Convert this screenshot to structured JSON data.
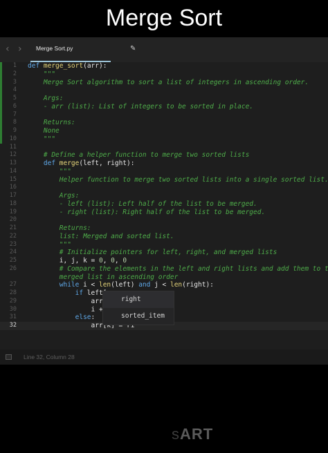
{
  "video_title": "Merge Sort",
  "tab": {
    "filename": "Merge Sort.py"
  },
  "code_lines": [
    {
      "n": "1",
      "tokens": [
        {
          "c": "kw",
          "t": "def "
        },
        {
          "c": "fn",
          "t": "merge_sort"
        },
        {
          "c": "ident",
          "t": "(arr):"
        }
      ]
    },
    {
      "n": "2",
      "tokens": [
        {
          "c": "doc",
          "t": "    \"\"\""
        }
      ]
    },
    {
      "n": "3",
      "tokens": [
        {
          "c": "doc",
          "t": "    Merge Sort algorithm to sort a list of integers in ascending order."
        }
      ]
    },
    {
      "n": "4",
      "tokens": []
    },
    {
      "n": "5",
      "tokens": [
        {
          "c": "doc",
          "t": "    Args:"
        }
      ]
    },
    {
      "n": "6",
      "tokens": [
        {
          "c": "doc",
          "t": "    - arr (list): List of integers to be sorted in place."
        }
      ]
    },
    {
      "n": "7",
      "tokens": []
    },
    {
      "n": "8",
      "tokens": [
        {
          "c": "doc",
          "t": "    Returns:"
        }
      ]
    },
    {
      "n": "9",
      "tokens": [
        {
          "c": "doc",
          "t": "    None"
        }
      ]
    },
    {
      "n": "10",
      "tokens": [
        {
          "c": "doc",
          "t": "    \"\"\""
        }
      ]
    },
    {
      "n": "11",
      "tokens": []
    },
    {
      "n": "12",
      "tokens": [
        {
          "c": "cm",
          "t": "    # Define a helper function to merge two sorted lists"
        }
      ]
    },
    {
      "n": "13",
      "tokens": [
        {
          "c": "kw",
          "t": "    def "
        },
        {
          "c": "fn",
          "t": "merge"
        },
        {
          "c": "ident",
          "t": "(left, right):"
        }
      ]
    },
    {
      "n": "14",
      "tokens": [
        {
          "c": "doc",
          "t": "        \"\"\""
        }
      ]
    },
    {
      "n": "15",
      "tokens": [
        {
          "c": "doc",
          "t": "        Helper function to merge two sorted lists into a single sorted list."
        }
      ]
    },
    {
      "n": "16",
      "tokens": []
    },
    {
      "n": "17",
      "tokens": [
        {
          "c": "doc",
          "t": "        Args:"
        }
      ]
    },
    {
      "n": "18",
      "tokens": [
        {
          "c": "doc",
          "t": "        - left (list): Left half of the list to be merged."
        }
      ]
    },
    {
      "n": "19",
      "tokens": [
        {
          "c": "doc",
          "t": "        - right (list): Right half of the list to be merged."
        }
      ]
    },
    {
      "n": "20",
      "tokens": []
    },
    {
      "n": "21",
      "tokens": [
        {
          "c": "doc",
          "t": "        Returns:"
        }
      ]
    },
    {
      "n": "22",
      "tokens": [
        {
          "c": "doc",
          "t": "        list: Merged and sorted list."
        }
      ]
    },
    {
      "n": "23",
      "tokens": [
        {
          "c": "doc",
          "t": "        \"\"\""
        }
      ]
    },
    {
      "n": "24",
      "tokens": [
        {
          "c": "cm",
          "t": "        # Initialize pointers for left, right, and merged lists"
        }
      ]
    },
    {
      "n": "25",
      "tokens": [
        {
          "c": "ident",
          "t": "        i, j, k = "
        },
        {
          "c": "num",
          "t": "0"
        },
        {
          "c": "ident",
          "t": ", "
        },
        {
          "c": "num",
          "t": "0"
        },
        {
          "c": "ident",
          "t": ", "
        },
        {
          "c": "num",
          "t": "0"
        }
      ]
    },
    {
      "n": "26",
      "tokens": [
        {
          "c": "cm",
          "t": "        # Compare the elements in the left and right lists and add them to the"
        }
      ]
    },
    {
      "n": "",
      "tokens": [
        {
          "c": "cm",
          "t": "        merged list in ascending order"
        }
      ]
    },
    {
      "n": "27",
      "tokens": [
        {
          "c": "kw",
          "t": "        while "
        },
        {
          "c": "ident",
          "t": "i < "
        },
        {
          "c": "fn",
          "t": "len"
        },
        {
          "c": "ident",
          "t": "(left) "
        },
        {
          "c": "kw",
          "t": "and "
        },
        {
          "c": "ident",
          "t": "j < "
        },
        {
          "c": "fn",
          "t": "len"
        },
        {
          "c": "ident",
          "t": "(right):"
        }
      ]
    },
    {
      "n": "28",
      "tokens": [
        {
          "c": "kw",
          "t": "            if "
        },
        {
          "c": "ident",
          "t": "left["
        }
      ]
    },
    {
      "n": "29",
      "tokens": [
        {
          "c": "ident",
          "t": "                arr["
        }
      ]
    },
    {
      "n": "30",
      "tokens": [
        {
          "c": "ident",
          "t": "                i +="
        }
      ]
    },
    {
      "n": "31",
      "tokens": [
        {
          "c": "kw",
          "t": "            else"
        },
        {
          "c": "ident",
          "t": ":"
        }
      ]
    },
    {
      "n": "32",
      "tokens": [
        {
          "c": "ident",
          "t": "                arr[k] = ri"
        }
      ]
    }
  ],
  "current_line": "32",
  "autocomplete": [
    "right",
    "sorted_item"
  ],
  "status": {
    "position": "Line 32, Column 28"
  },
  "watermark": {
    "prefix": "s",
    "main": "ART"
  },
  "colors": {
    "accent": "#9dc4d8",
    "keyword": "#5fa8e8",
    "function": "#e6d57a",
    "docstring": "#4fae4a"
  }
}
